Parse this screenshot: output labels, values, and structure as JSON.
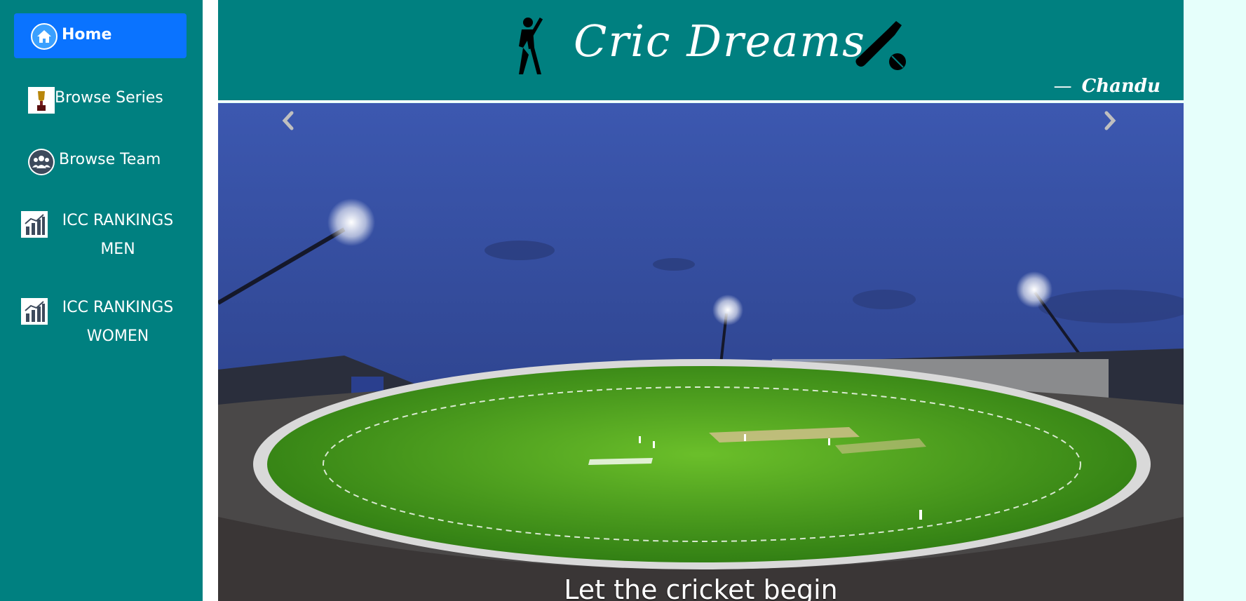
{
  "sidebar": {
    "items": [
      {
        "label": "Home",
        "icon": "home-icon",
        "active": true
      },
      {
        "label": "Browse Series",
        "icon": "trophy-icon"
      },
      {
        "label": "Browse Team",
        "icon": "team-icon"
      },
      {
        "label": "ICC RANKINGS MEN",
        "icon": "bar-chart-icon"
      },
      {
        "label": "ICC RANKINGS WOMEN",
        "icon": "bar-chart-icon"
      }
    ]
  },
  "header": {
    "title": "Cric Dreams",
    "byline_dash": "—",
    "byline": "Chandu",
    "left_icon": "batsman-icon",
    "right_icon": "bat-and-ball-icon"
  },
  "carousel": {
    "caption": "Let the cricket begin",
    "image": "cricket-stadium-at-night",
    "prev_icon": "chevron-left-icon",
    "next_icon": "chevron-right-icon"
  },
  "colors": {
    "sidebar_bg": "#008080",
    "active_item_bg": "#0a73ff",
    "page_bg": "#e6fffb",
    "text": "#ffffff"
  }
}
